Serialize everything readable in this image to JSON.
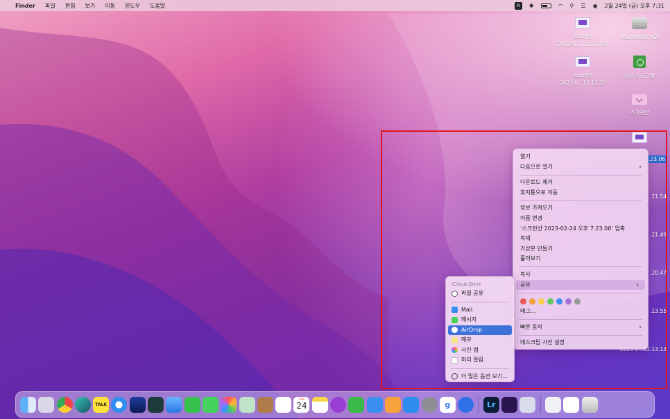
{
  "menubar": {
    "apple": "",
    "app_name": "Finder",
    "items": [
      "파일",
      "편집",
      "보기",
      "이동",
      "윈도우",
      "도움말"
    ],
    "input_indicator": "A",
    "clock": "2월 24일 (금) 오후 7:31"
  },
  "desktop": {
    "icons": [
      {
        "line1": "스크린샷",
        "line2": "2023-02...12.12.09"
      },
      {
        "line1": "Macintosh HD",
        "line2": ""
      },
      {
        "line1": "스크린샷",
        "line2": "2023-0...12.11.39"
      },
      {
        "line1": "응용 프로그램",
        "line2": ""
      },
      {
        "line1": "스크린샷",
        "line2": ""
      }
    ],
    "partial_labels": [
      ".23.06",
      ".21.54",
      ".21.49",
      ".20.47",
      ".13.55",
      "2023-0...12.13.13"
    ]
  },
  "context_menu": {
    "open": "열기",
    "open_with": "다음으로 열기",
    "remove_download": "다운로드 제거",
    "move_to_trash": "휴지통으로 이동",
    "get_info": "정보 가져오기",
    "rename": "이름 변경",
    "compress": "‘스크린샷 2023-02-24 오후 7.23.06’ 압축",
    "duplicate": "복제",
    "make_alias": "가상본 만들기",
    "quick_look": "훑어보기",
    "copy": "복사",
    "share": "공유",
    "tag_colors": [
      "#ef5b55",
      "#f3a03a",
      "#f5cf45",
      "#5fc956",
      "#3d8ff0",
      "#a773d9",
      "#9a9a9a"
    ],
    "tags": "태그...",
    "quick_actions": "빠른 동작",
    "set_desktop_picture": "데스크탑 사진 설정"
  },
  "share_menu": {
    "header": "iCloud Drive",
    "file_share": "파일 공유",
    "mail": "Mail",
    "messages": "메시지",
    "airdrop": "AirDrop",
    "notes": "메모",
    "photos": "사진 앱",
    "reminders": "미리 알림",
    "more": "더 많은 옵션 보기..."
  },
  "dock": {
    "calendar_day": "24",
    "kakao": "TALK",
    "lightroom": "Lr",
    "gmail_like": "g"
  },
  "colors": {
    "accent": "#3d73d9",
    "highlight_border": "#e0161e"
  }
}
